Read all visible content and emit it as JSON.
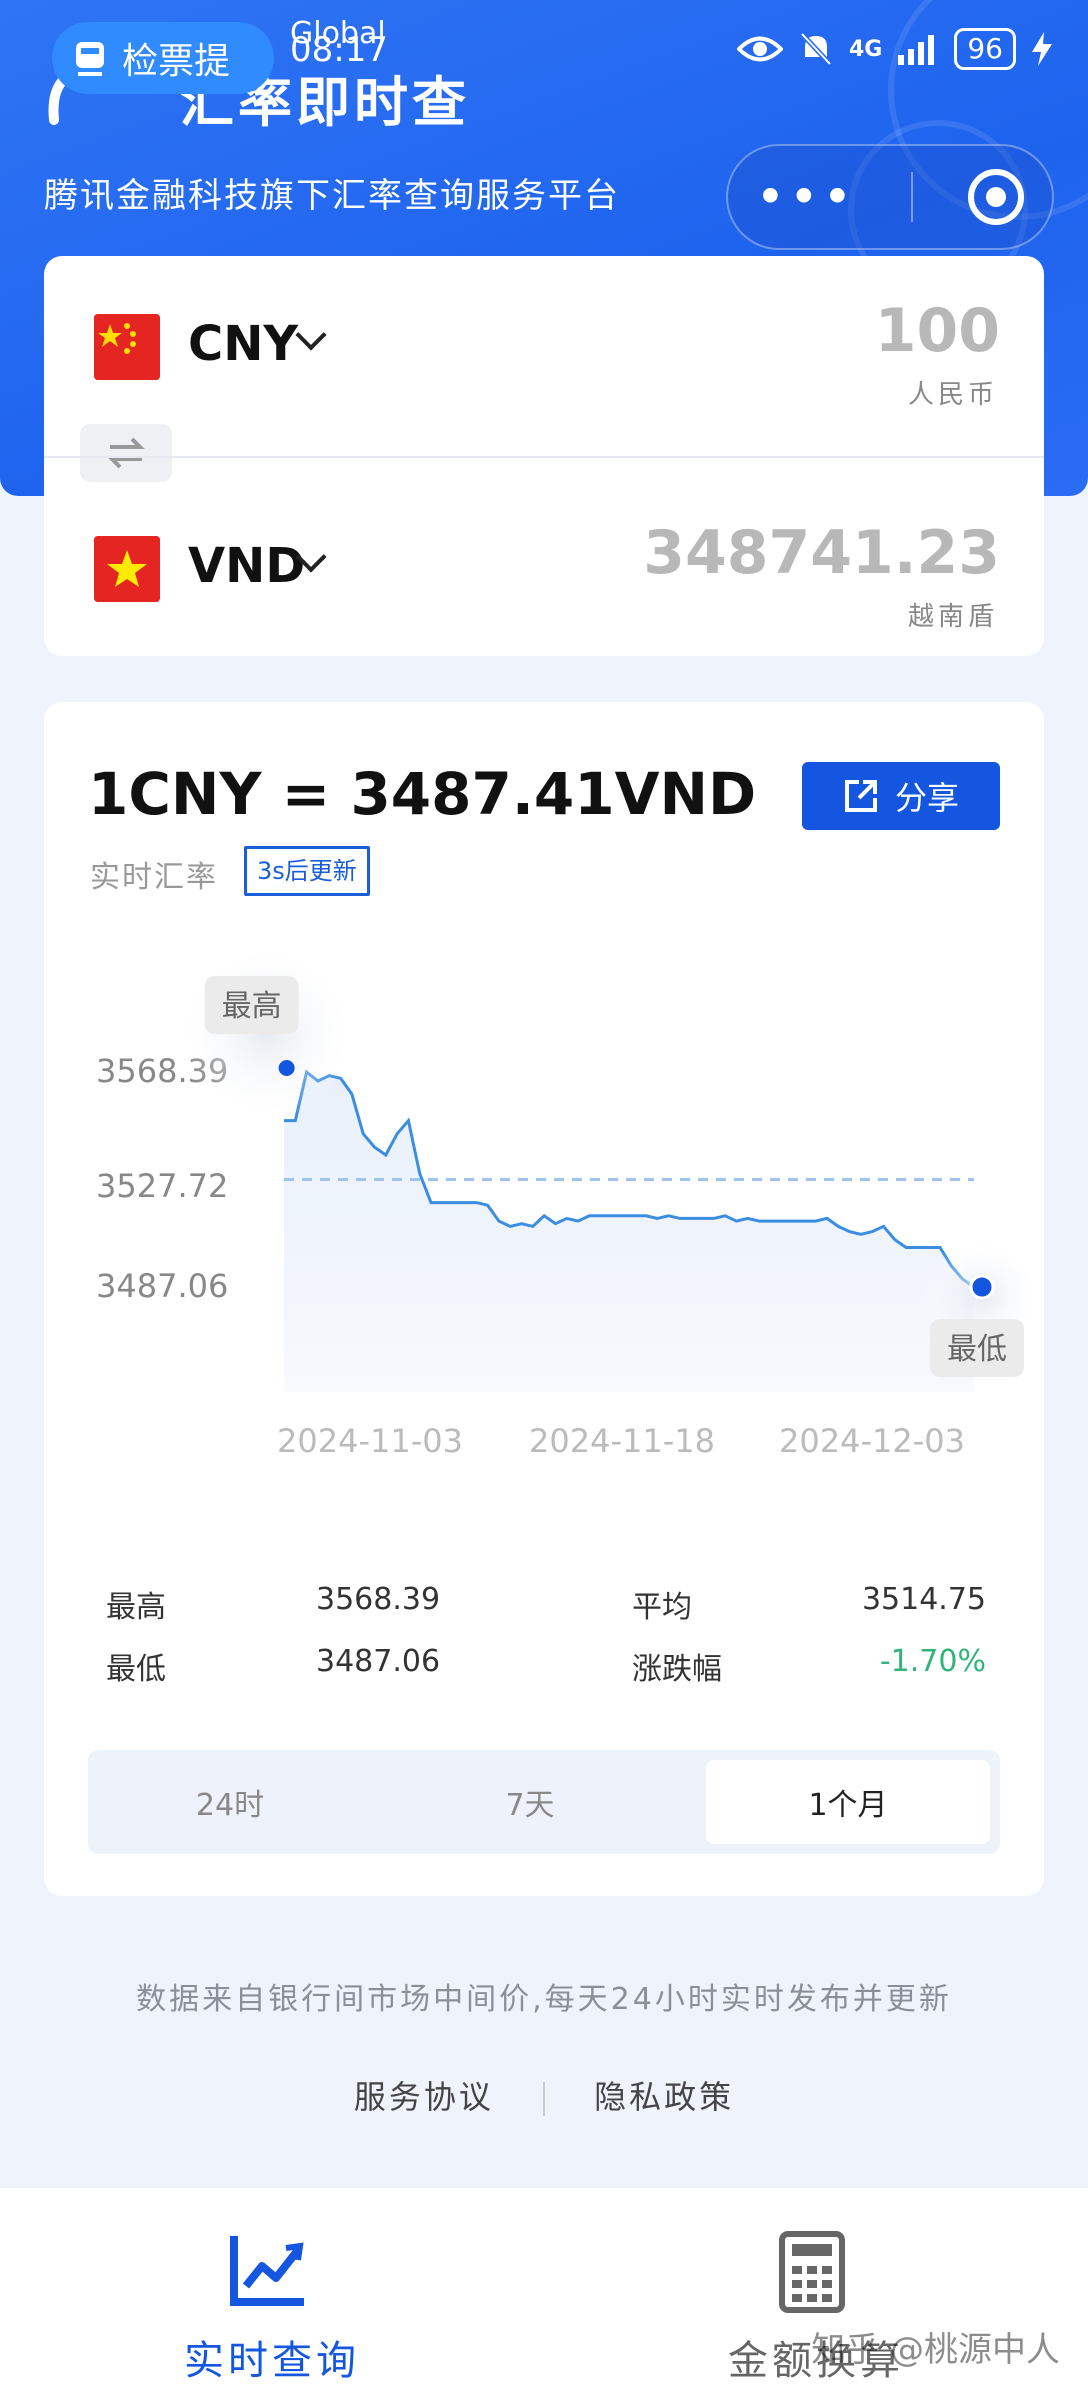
{
  "status_bar": {
    "carrier": "Global",
    "time": "08:17",
    "network": "4G",
    "battery": "96"
  },
  "header": {
    "mini_program_tag": "检票提",
    "app_title": "汇率即时查",
    "subtitle": "腾讯金融科技旗下汇率查询服务平台"
  },
  "converter": {
    "from": {
      "code": "CNY",
      "amount": "100",
      "name": "人民币"
    },
    "to": {
      "code": "VND",
      "amount": "348741.23",
      "name": "越南盾"
    }
  },
  "rate_card": {
    "rate_line": "1CNY = 3487.41VND",
    "realtime_label": "实时汇率",
    "refresh_badge": "3s后更新",
    "share_label": "分享"
  },
  "chart_data": {
    "type": "line",
    "y_ticks": [
      "3568.39",
      "3527.72",
      "3487.06"
    ],
    "x_ticks": [
      "2024-11-03",
      "2024-11-18",
      "2024-12-03"
    ],
    "ylim": [
      3480,
      3575
    ],
    "reference_line": 3527.72,
    "high_marker": {
      "label": "最高",
      "value": 3568.39
    },
    "low_marker": {
      "label": "最低",
      "value": 3487.06
    },
    "line_color": "#3a8de0",
    "points": [
      3550,
      3550,
      3568.39,
      3565,
      3567,
      3566,
      3560,
      3545,
      3540,
      3537,
      3545,
      3550,
      3530,
      3519,
      3519,
      3519,
      3519,
      3519,
      3518,
      3512,
      3510,
      3511,
      3510,
      3514,
      3511,
      3513,
      3512,
      3514,
      3514,
      3514,
      3514,
      3514,
      3514,
      3513,
      3514,
      3513,
      3513,
      3513,
      3513,
      3514,
      3512,
      3513,
      3512,
      3512,
      3512,
      3512,
      3512,
      3512,
      3513,
      3510,
      3508,
      3507,
      3508,
      3510,
      3505,
      3502,
      3502,
      3502,
      3502,
      3495,
      3490,
      3487.06
    ]
  },
  "stats": {
    "high_label": "最高",
    "high": "3568.39",
    "avg_label": "平均",
    "avg": "3514.75",
    "low_label": "最低",
    "low": "3487.06",
    "change_label": "涨跌幅",
    "change": "-1.70%"
  },
  "range_tabs": [
    "24时",
    "7天",
    "1个月"
  ],
  "selected_range": "1个月",
  "footer": {
    "source_note": "数据来自银行间市场中间价,每天24小时实时发布并更新",
    "terms": "服务协议",
    "privacy": "隐私政策"
  },
  "bottom_nav": [
    {
      "label": "实时查询",
      "icon": "line-chart-icon",
      "active": true
    },
    {
      "label": "金额换算",
      "icon": "calculator-icon",
      "active": false
    }
  ],
  "watermark": "知乎 @桃源中人",
  "colors": {
    "brand_blue": "#1e63ee",
    "accent_blue": "#1456df",
    "down_green": "#2fb57a"
  }
}
